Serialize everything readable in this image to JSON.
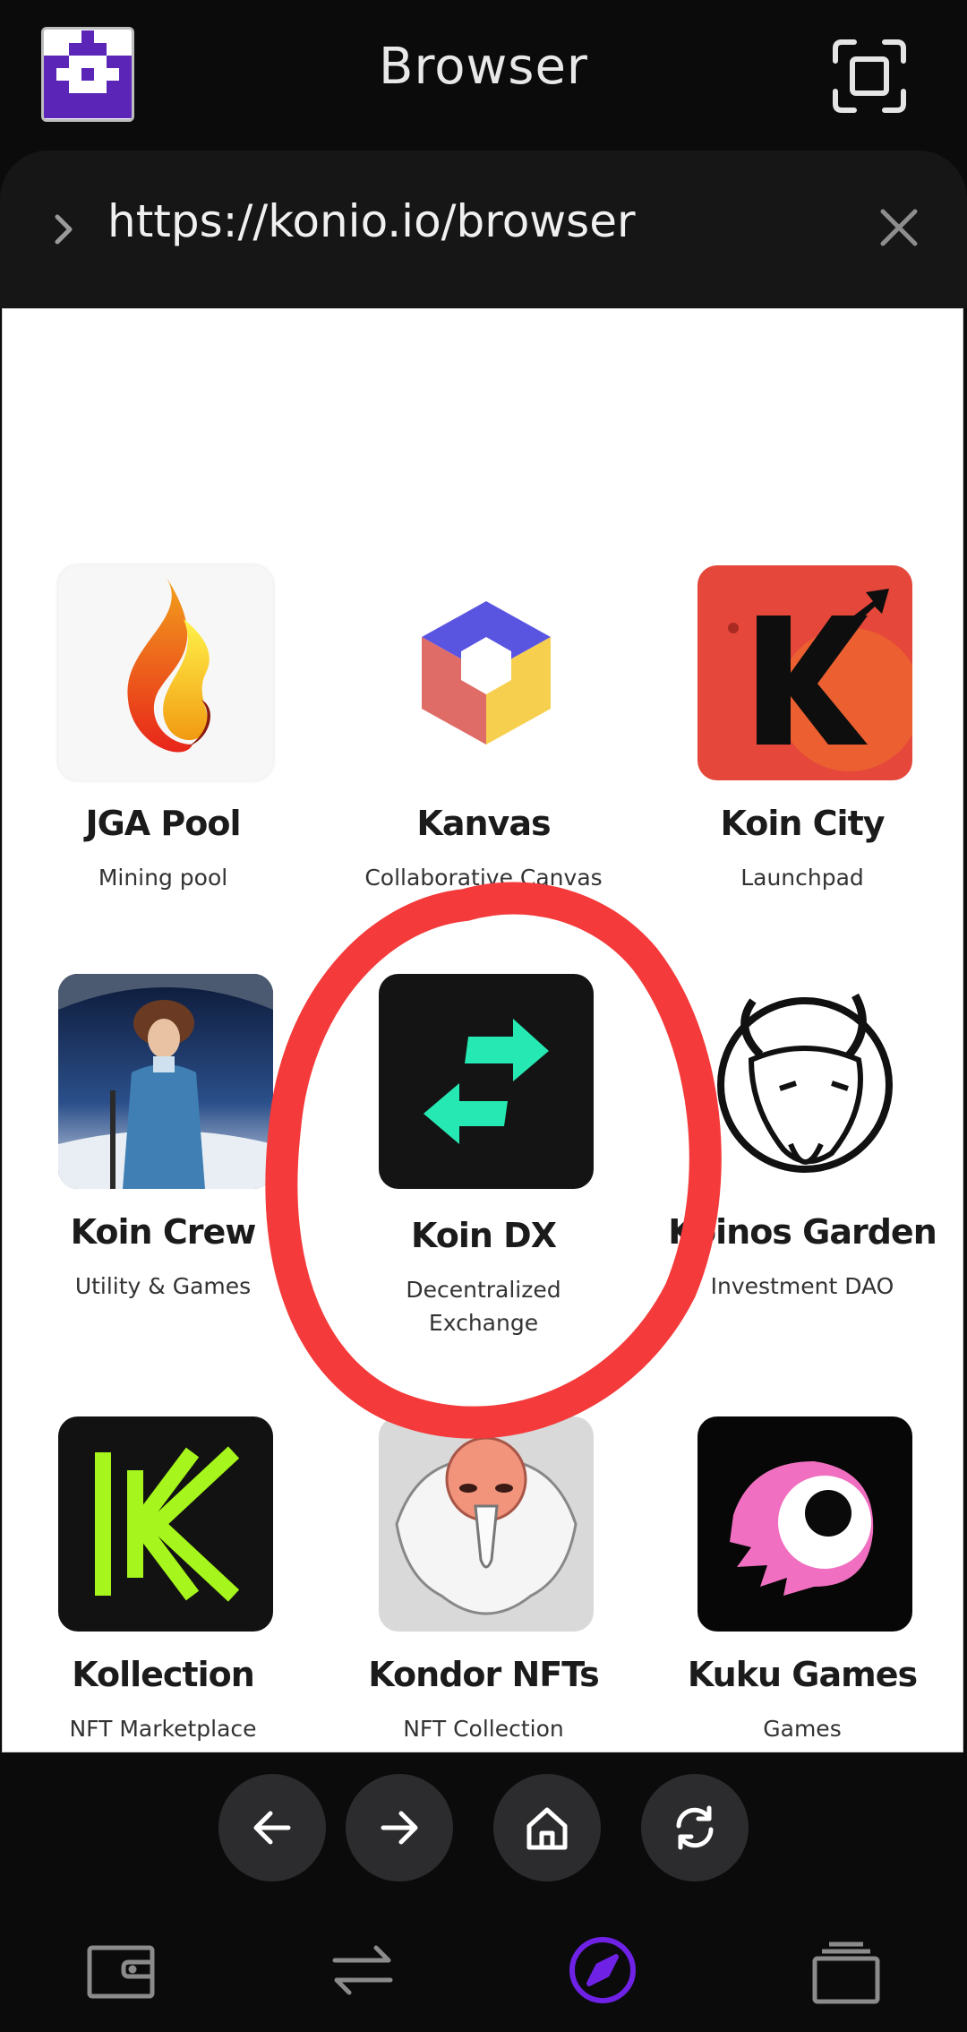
{
  "header": {
    "title": "Browser"
  },
  "urlbar": {
    "url": "https://konio.io/browser"
  },
  "apps": [
    {
      "name": "JGA Pool",
      "desc": "Mining pool"
    },
    {
      "name": "Kanvas",
      "desc": "Collaborative Canvas"
    },
    {
      "name": "Koin City",
      "desc": "Launchpad"
    },
    {
      "name": "Koin Crew",
      "desc": "Utility & Games"
    },
    {
      "name": "Koin DX",
      "desc": "Decentralized Exchange"
    },
    {
      "name": "Koinos Garden",
      "desc": "Investment DAO"
    },
    {
      "name": "Kollection",
      "desc": "NFT Marketplace"
    },
    {
      "name": "Kondor NFTs",
      "desc": "NFT Collection"
    },
    {
      "name": "Kuku Games",
      "desc": "Games"
    }
  ],
  "navigation": [
    "back-icon",
    "forward-icon",
    "home-icon",
    "refresh-icon"
  ],
  "tabs": [
    {
      "icon": "wallet-icon",
      "active": false
    },
    {
      "icon": "swap-icon",
      "active": false
    },
    {
      "icon": "compass-icon",
      "active": true
    },
    {
      "icon": "stack-icon",
      "active": false
    }
  ],
  "colors": {
    "accent": "#6f22e6",
    "annotation": "#f43a3a",
    "background": "#0b0b0c"
  }
}
